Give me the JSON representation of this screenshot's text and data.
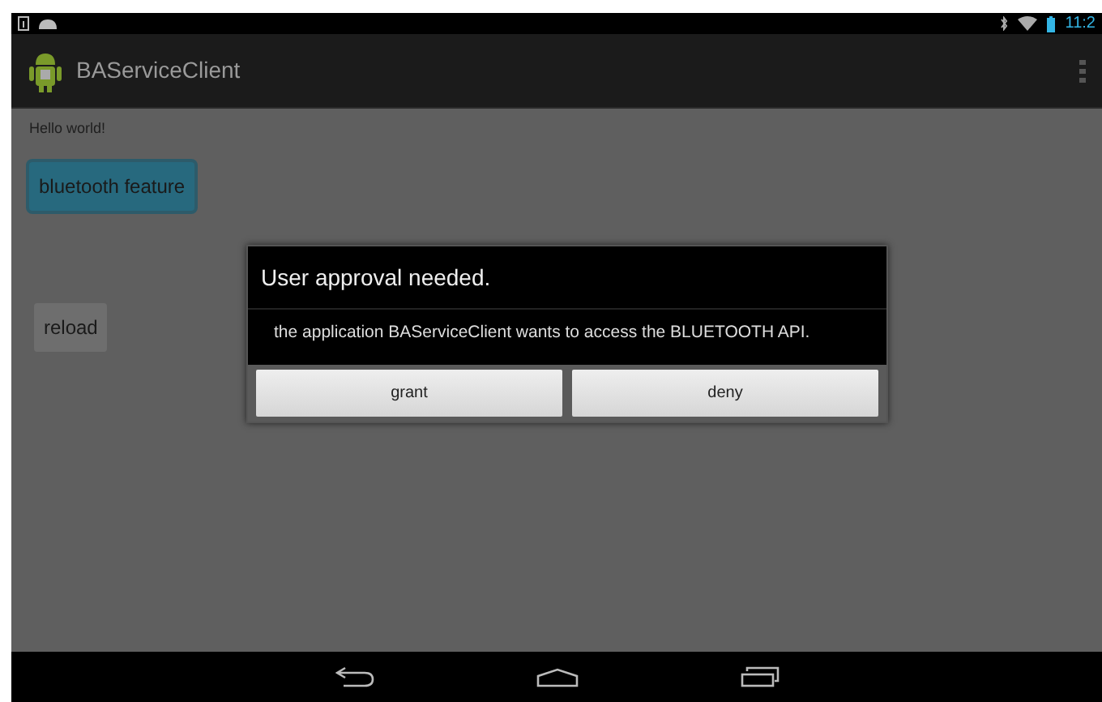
{
  "status_bar": {
    "time": "11:2"
  },
  "action_bar": {
    "title": "BAServiceClient"
  },
  "content": {
    "text": "Hello world!",
    "buttons": [
      {
        "label": "bluetooth feature",
        "kind": "focused"
      },
      {
        "label": "reload",
        "kind": "plain"
      }
    ]
  },
  "dialog": {
    "title": "User approval needed.",
    "message": "the application BAServiceClient wants to access the BLUETOOTH API.",
    "buttons": [
      "grant",
      "deny"
    ]
  }
}
